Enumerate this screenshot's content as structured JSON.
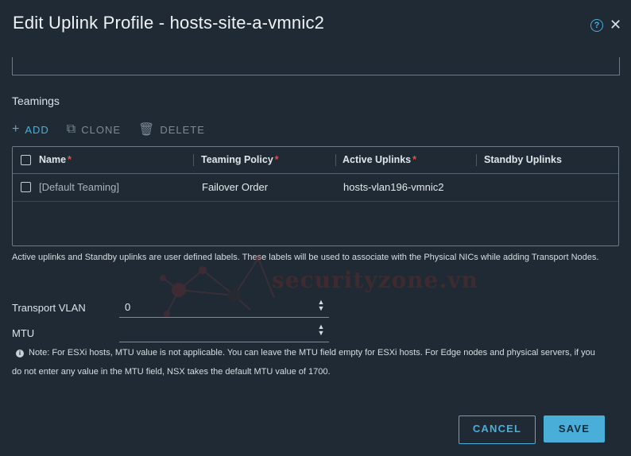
{
  "dialog": {
    "title": "Edit Uplink Profile - hosts-site-a-vmnic2",
    "help_icon": "question-circle-icon",
    "close_icon": "close-icon"
  },
  "teamings": {
    "section_title": "Teamings",
    "toolbar": {
      "add_label": "ADD",
      "clone_label": "CLONE",
      "delete_label": "DELETE"
    },
    "columns": [
      {
        "label": "Name",
        "required": "*"
      },
      {
        "label": "Teaming Policy",
        "required": "*"
      },
      {
        "label": "Active Uplinks",
        "required": "*"
      },
      {
        "label": "Standby Uplinks",
        "required": ""
      }
    ],
    "rows": [
      {
        "name": "[Default Teaming]",
        "policy": "Failover Order",
        "active": "hosts-vlan196-vmnic2",
        "standby": ""
      }
    ],
    "help_text": "Active uplinks and Standby uplinks are user defined labels. These labels will be used to associate with the Physical NICs while adding Transport Nodes."
  },
  "transport_vlan": {
    "label": "Transport VLAN",
    "value": "0"
  },
  "mtu": {
    "label": "MTU",
    "value": ""
  },
  "note": "Note: For ESXi hosts, MTU value is not applicable. You can leave the MTU field empty for ESXi hosts. For Edge nodes and physical servers, if you do not enter any value in the MTU field, NSX takes the default MTU value of 1700.",
  "buttons": {
    "cancel": "CANCEL",
    "save": "SAVE"
  },
  "watermark": "securityzone.vn",
  "colors": {
    "accent": "#49afd9",
    "background": "#1f2a34",
    "required": "#e2504d"
  }
}
